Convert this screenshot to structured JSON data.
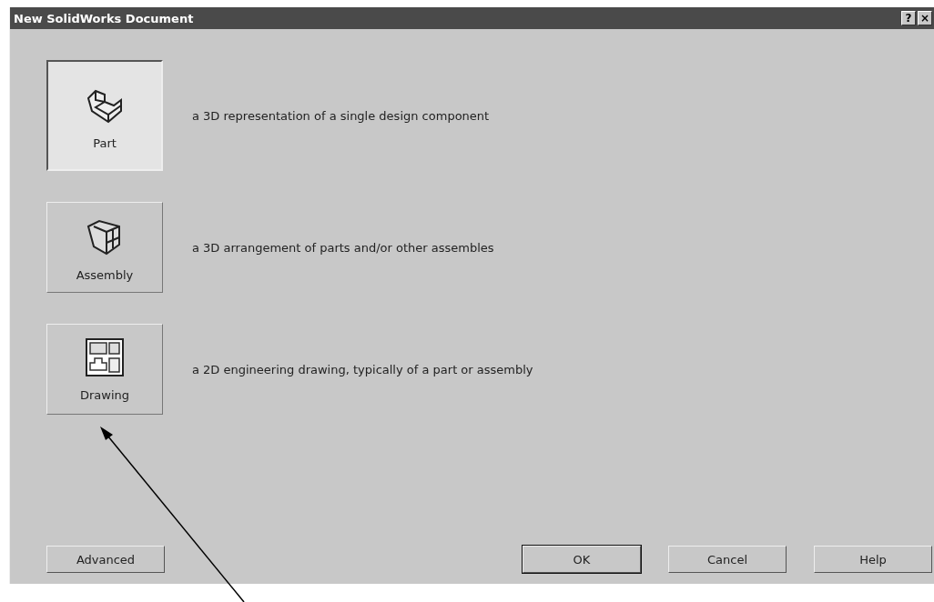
{
  "window": {
    "title": "New SolidWorks Document",
    "controls": [
      "?",
      "×"
    ]
  },
  "templates": [
    {
      "kind": "part",
      "label": "Part",
      "description": "a 3D representation of a single design component",
      "selected": true
    },
    {
      "kind": "assembly",
      "label": "Assembly",
      "description": "a 3D arrangement of parts and/or other assembles",
      "selected": false
    },
    {
      "kind": "drawing",
      "label": "Drawing",
      "description": "a 2D engineering drawing, typically of a part or assembly",
      "selected": false
    }
  ],
  "buttons": [
    {
      "label": "Advanced",
      "default": false
    },
    {
      "label": "OK",
      "default": true
    },
    {
      "label": "Cancel",
      "default": false
    },
    {
      "label": "Help",
      "default": false
    }
  ]
}
